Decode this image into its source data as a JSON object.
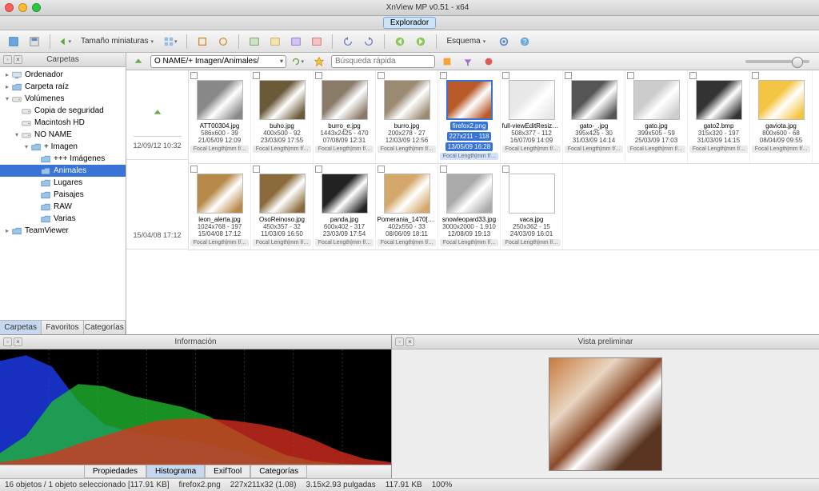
{
  "window": {
    "title": "XnView MP v0.51 - x64",
    "mode_badge": "Explorador"
  },
  "toolbar": {
    "thumb_size_label": "Tamaño miniaturas",
    "scheme_label": "Esquema"
  },
  "sidebar": {
    "header": "Carpetas",
    "tabs": [
      "Carpetas",
      "Favoritos",
      "Categorías"
    ],
    "tree": [
      {
        "label": "Ordenador",
        "depth": 0,
        "arrow": "▸",
        "icon": "computer"
      },
      {
        "label": "Carpeta raíz",
        "depth": 0,
        "arrow": "▸",
        "icon": "folder"
      },
      {
        "label": "Volúmenes",
        "depth": 0,
        "arrow": "▾",
        "icon": "drive"
      },
      {
        "label": "Copia de seguridad",
        "depth": 1,
        "arrow": "",
        "icon": "drive"
      },
      {
        "label": "Macintosh HD",
        "depth": 1,
        "arrow": "",
        "icon": "drive"
      },
      {
        "label": "NO NAME",
        "depth": 1,
        "arrow": "▾",
        "icon": "drive"
      },
      {
        "label": "+ Imagen",
        "depth": 2,
        "arrow": "▾",
        "icon": "folder"
      },
      {
        "label": "+++ Imágenes",
        "depth": 3,
        "arrow": "",
        "icon": "folder"
      },
      {
        "label": "Animales",
        "depth": 3,
        "arrow": "",
        "icon": "folder",
        "selected": true
      },
      {
        "label": "Lugares",
        "depth": 3,
        "arrow": "",
        "icon": "folder"
      },
      {
        "label": "Paisajes",
        "depth": 3,
        "arrow": "",
        "icon": "folder"
      },
      {
        "label": "RAW",
        "depth": 3,
        "arrow": "",
        "icon": "folder"
      },
      {
        "label": "Varias",
        "depth": 3,
        "arrow": "",
        "icon": "folder"
      },
      {
        "label": "TeamViewer",
        "depth": 0,
        "arrow": "▸",
        "icon": "folder"
      }
    ]
  },
  "location": {
    "path": "O NAME/+ Imagen/Animales/",
    "search_placeholder": "Búsqueda rápida"
  },
  "date_groups": [
    "12/09/12 10:32",
    "15/04/08 17:12"
  ],
  "thumbnails": [
    [
      {
        "name": "ATT00304.jpg",
        "dims": "586x600 - 39",
        "date": "21/05/09 12:09",
        "col": "#888"
      },
      {
        "name": "buho.jpg",
        "dims": "400x500 - 92",
        "date": "23/03/09 17:55",
        "col": "#6b5a3a"
      },
      {
        "name": "burro_e.jpg",
        "dims": "1443x2425 - 470",
        "date": "07/08/09 12:31",
        "col": "#8a7a68"
      },
      {
        "name": "burro.jpg",
        "dims": "200x278 - 27",
        "date": "12/03/09 12:56",
        "col": "#9a8a72"
      },
      {
        "name": "firefox2.png",
        "dims": "227x211 - 118",
        "date": "13/05/09 16:28",
        "col": "#b85a2a",
        "selected": true
      },
      {
        "name": "full-viewEditResize.gif",
        "dims": "508x377 - 112",
        "date": "16/07/09 14:09",
        "col": "#e8e8e8"
      },
      {
        "name": "gato-_.jpg",
        "dims": "395x425 - 30",
        "date": "31/03/09 14:14",
        "col": "#555"
      },
      {
        "name": "gato.jpg",
        "dims": "399x505 - 59",
        "date": "25/03/09 17:03",
        "col": "#ccc"
      },
      {
        "name": "gato2.bmp",
        "dims": "315x320 - 197",
        "date": "31/03/09 14:15",
        "col": "#333"
      },
      {
        "name": "gaviota.jpg",
        "dims": "800x600 - 68",
        "date": "08/04/09 09:55",
        "col": "#f4c542"
      }
    ],
    [
      {
        "name": "leon_alerta.jpg",
        "dims": "1024x768 - 197",
        "date": "15/04/08 17:12",
        "col": "#b88a4a"
      },
      {
        "name": "OsoReinoso.jpg",
        "dims": "450x357 - 32",
        "date": "11/03/09 16:50",
        "col": "#8a6a3a"
      },
      {
        "name": "panda.jpg",
        "dims": "600x402 - 317",
        "date": "23/03/09 17:54",
        "col": "#222"
      },
      {
        "name": "Pomerania_1470[1].jpg",
        "dims": "402x550 - 33",
        "date": "08/06/09 18:11",
        "col": "#d4a86a"
      },
      {
        "name": "snowleopard33.jpg",
        "dims": "3000x2000 - 1.910",
        "date": "12/08/09 19:13",
        "col": "#aaa"
      },
      {
        "name": "vaca.jpg",
        "dims": "250x362 - 15",
        "date": "24/03/09 16:01",
        "col": "#fff"
      }
    ]
  ],
  "meta_label": "Focal Length|mm f/...",
  "info_panel": {
    "header": "Información",
    "tabs": [
      "Propiedades",
      "Histograma",
      "ExifTool",
      "Categorías"
    ]
  },
  "preview_panel": {
    "header": "Vista preliminar"
  },
  "status": {
    "objects": "16 objetos / 1 objeto seleccionado [117.91 KB]",
    "file": "firefox2.png",
    "dims": "227x211x32 (1.08)",
    "phys": "3.15x2.93 pulgadas",
    "size": "117.91 KB",
    "zoom": "100%"
  },
  "chart_data": {
    "type": "area",
    "title": "Histograma",
    "xlim": [
      0,
      255
    ],
    "ylim": [
      0,
      1
    ],
    "series": [
      {
        "name": "Blue",
        "color": "#2040ff",
        "values": [
          0.9,
          0.95,
          0.85,
          0.55,
          0.35,
          0.28,
          0.25,
          0.22,
          0.18,
          0.12,
          0.05,
          0.02,
          0.0,
          0.0,
          0.0,
          0.0
        ]
      },
      {
        "name": "Green",
        "color": "#20c030",
        "values": [
          0.1,
          0.25,
          0.55,
          0.7,
          0.68,
          0.6,
          0.55,
          0.5,
          0.42,
          0.3,
          0.18,
          0.08,
          0.03,
          0.01,
          0.0,
          0.0
        ]
      },
      {
        "name": "Red",
        "color": "#e03020",
        "values": [
          0.02,
          0.05,
          0.1,
          0.18,
          0.25,
          0.32,
          0.38,
          0.4,
          0.4,
          0.38,
          0.35,
          0.3,
          0.22,
          0.12,
          0.05,
          0.02
        ]
      }
    ]
  }
}
